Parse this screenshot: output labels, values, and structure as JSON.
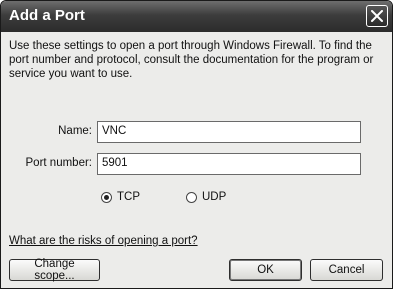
{
  "window": {
    "title": "Add a Port",
    "close_icon": "close-icon"
  },
  "description": "Use these settings to open a port through Windows Firewall. To find the port number and protocol, consult the documentation for the program or service you want to use.",
  "form": {
    "name_label": "Name:",
    "name_value": "VNC",
    "port_label": "Port number:",
    "port_value": "5901"
  },
  "protocol": {
    "options": [
      {
        "label": "TCP",
        "checked": true
      },
      {
        "label": "UDP",
        "checked": false
      }
    ]
  },
  "risks_link": "What are the risks of opening a port?",
  "buttons": {
    "change_scope": "Change scope...",
    "ok": "OK",
    "cancel": "Cancel"
  }
}
